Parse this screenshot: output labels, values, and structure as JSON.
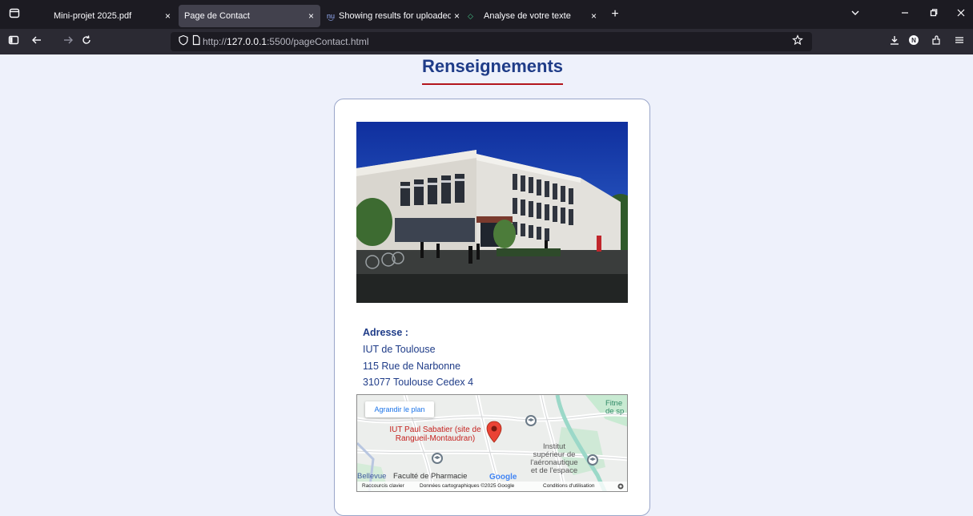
{
  "browser": {
    "tabs": [
      {
        "title": "Mini-projet 2025.pdf"
      },
      {
        "title": "Page de Contact"
      },
      {
        "title": "Showing results for uploaded fi"
      },
      {
        "title": "Analyse de votre texte"
      }
    ],
    "tab_close_glyph": "×",
    "new_tab_glyph": "+",
    "url_prefix": "http://",
    "url_host": "127.0.0.1",
    "url_rest": ":5500/pageContact.html"
  },
  "page": {
    "heading": "Renseignements",
    "accent_color": "#1f3c88",
    "underline_color": "#b3161d"
  },
  "address": {
    "label": "Adresse :",
    "lines": [
      "IUT de Toulouse",
      "115 Rue de Narbonne",
      "31077 Toulouse Cedex 4"
    ]
  },
  "map": {
    "enlarge_button": "Agrandir le plan",
    "place_label_1": "IUT Paul Sabatier (site de",
    "place_label_2": "Rangueil-Montaudran)",
    "institute_1": "Institut",
    "institute_2": "supérieur de",
    "institute_3": "l'aéronautique",
    "institute_4": "et de l'espace",
    "pharmacy": "Faculté de Pharmacie",
    "bellevue": "Bellevue",
    "fitness_1": "Fitne",
    "fitness_2": "de sp",
    "google": "Google",
    "footer_shortcuts": "Raccourcis clavier",
    "footer_data": "Données cartographiques ©2025 Google",
    "footer_terms": "Conditions d'utilisation"
  }
}
